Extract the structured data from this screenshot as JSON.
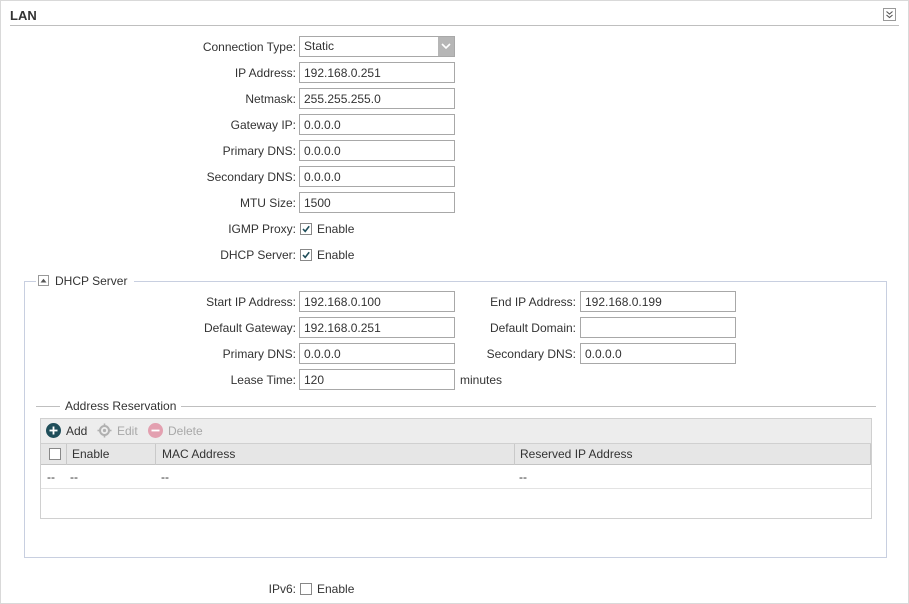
{
  "section_title": "LAN",
  "connection": {
    "type_label": "Connection Type:",
    "type_value": "Static",
    "ip_label": "IP Address:",
    "ip_value": "192.168.0.251",
    "netmask_label": "Netmask:",
    "netmask_value": "255.255.255.0",
    "gateway_label": "Gateway IP:",
    "gateway_value": "0.0.0.0",
    "primary_dns_label": "Primary DNS:",
    "primary_dns_value": "0.0.0.0",
    "secondary_dns_label": "Secondary DNS:",
    "secondary_dns_value": "0.0.0.0",
    "mtu_label": "MTU Size:",
    "mtu_value": "1500",
    "igmp_label": "IGMP Proxy:",
    "igmp_enable_label": "Enable",
    "igmp_checked": true,
    "dhcp_label": "DHCP Server:",
    "dhcp_enable_label": "Enable",
    "dhcp_checked": true
  },
  "dhcp_server": {
    "legend": "DHCP Server",
    "start_ip_label": "Start IP Address:",
    "start_ip_value": "192.168.0.100",
    "end_ip_label": "End IP Address:",
    "end_ip_value": "192.168.0.199",
    "default_gateway_label": "Default Gateway:",
    "default_gateway_value": "192.168.0.251",
    "default_domain_label": "Default Domain:",
    "default_domain_value": "",
    "primary_dns_label": "Primary DNS:",
    "primary_dns_value": "0.0.0.0",
    "secondary_dns_label": "Secondary DNS:",
    "secondary_dns_value": "0.0.0.0",
    "lease_time_label": "Lease Time:",
    "lease_time_value": "120",
    "lease_time_unit": "minutes"
  },
  "address_reservation": {
    "title": "Address Reservation",
    "toolbar": {
      "add": "Add",
      "edit": "Edit",
      "delete": "Delete"
    },
    "columns": [
      "Enable",
      "MAC Address",
      "Reserved IP Address"
    ],
    "rows": [
      {
        "select": "--",
        "enable": "--",
        "mac": "--",
        "reserved_ip": "--"
      }
    ]
  },
  "ipv6": {
    "label": "IPv6:",
    "enable_label": "Enable",
    "checked": false
  },
  "colors": {
    "add_icon": "#1f4e5a",
    "disabled": "#a8a8a8",
    "delete_icon": "#e3a0b0"
  },
  "icons": {
    "collapse": "double-chevron-down-icon",
    "fieldset_toggle": "minus-icon",
    "add": "plus-circle-icon",
    "edit": "gear-icon",
    "delete": "minus-circle-icon",
    "dropdown": "chevron-down-icon",
    "check": "checkmark-icon"
  }
}
